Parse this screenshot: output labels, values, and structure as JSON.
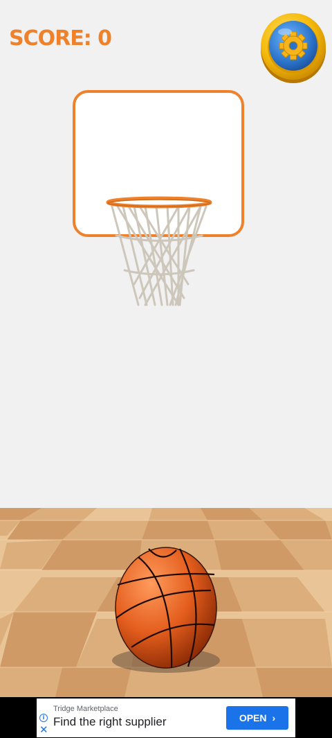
{
  "hud": {
    "score_label": "SCORE: 0",
    "settings_icon": "gear-icon"
  },
  "colors": {
    "accent_orange": "#f0812b",
    "wall": "#f1f1f1",
    "ad_button": "#1a73e8"
  },
  "ad": {
    "advertiser": "Tridge Marketplace",
    "headline": "Find the right supplier",
    "cta_label": "OPEN",
    "info_icon": "info-icon",
    "close_icon": "close-icon"
  }
}
